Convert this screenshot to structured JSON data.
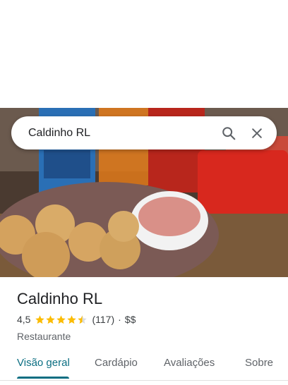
{
  "search": {
    "query": "Caldinho RL"
  },
  "place": {
    "name": "Caldinho RL",
    "rating": "4,5",
    "rating_value": 4.5,
    "reviews": "(117)",
    "separator": "·",
    "price": "$$",
    "category": "Restaurante"
  },
  "tabs": [
    {
      "label": "Visão geral",
      "active": true
    },
    {
      "label": "Cardápio"
    },
    {
      "label": "Avaliações"
    },
    {
      "label": "Sobre"
    }
  ],
  "colors": {
    "accent": "#0b6e82",
    "star": "#fbbc04"
  },
  "icons": {
    "search": "search-icon",
    "close": "close-icon"
  }
}
